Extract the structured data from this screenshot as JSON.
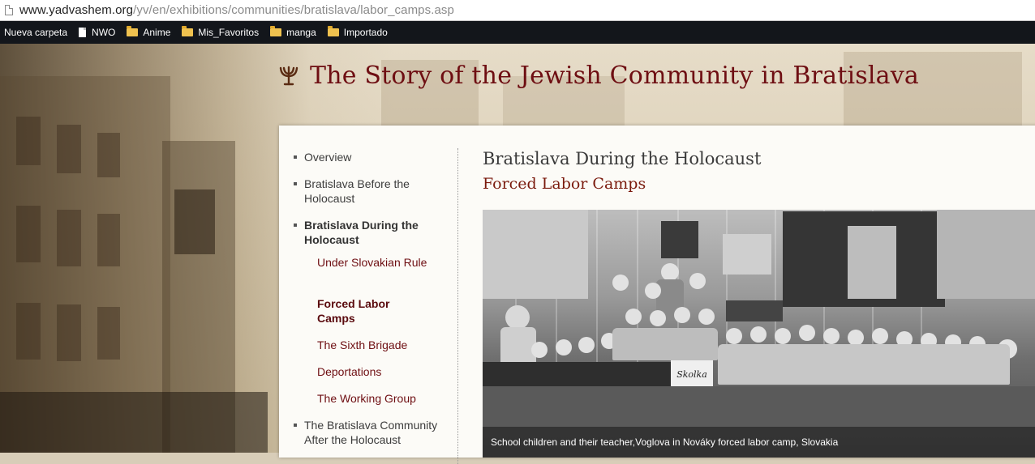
{
  "browser": {
    "url_host": "www.yadvashem.org",
    "url_path": "/yv/en/exhibitions/communities/bratislava/labor_camps.asp"
  },
  "bookmarks": [
    {
      "label": "Nueva carpeta",
      "icon": "none"
    },
    {
      "label": "NWO",
      "icon": "file-icon"
    },
    {
      "label": "Anime",
      "icon": "folder-icon"
    },
    {
      "label": "Mis_Favoritos",
      "icon": "folder-icon"
    },
    {
      "label": "manga",
      "icon": "folder-icon"
    },
    {
      "label": "Importado",
      "icon": "folder-icon"
    }
  ],
  "site": {
    "title": "The Story of the Jewish Community in Bratislava",
    "logo_icon": "menorah-icon",
    "title_color": "#6e0e12"
  },
  "nav": {
    "items": [
      {
        "label": "Overview"
      },
      {
        "label": "Bratislava Before the Holocaust"
      },
      {
        "label": "Bratislava During the Holocaust",
        "active": true
      },
      {
        "label": "The Bratislava Community After the Holocaust"
      }
    ],
    "subitems": [
      {
        "label": "Under Slovakian Rule"
      },
      {
        "label": "Forced Labor Camps",
        "current": true
      },
      {
        "label": "The Sixth Brigade"
      },
      {
        "label": "Deportations"
      },
      {
        "label": "The Working Group"
      }
    ]
  },
  "content": {
    "heading": "Bratislava During the Holocaust",
    "subheading": "Forced Labor Camps",
    "photo_caption": "School children and their teacher,Voglova in Nováky forced labor camp, Slovakia",
    "photo_sign": "Skolka"
  }
}
